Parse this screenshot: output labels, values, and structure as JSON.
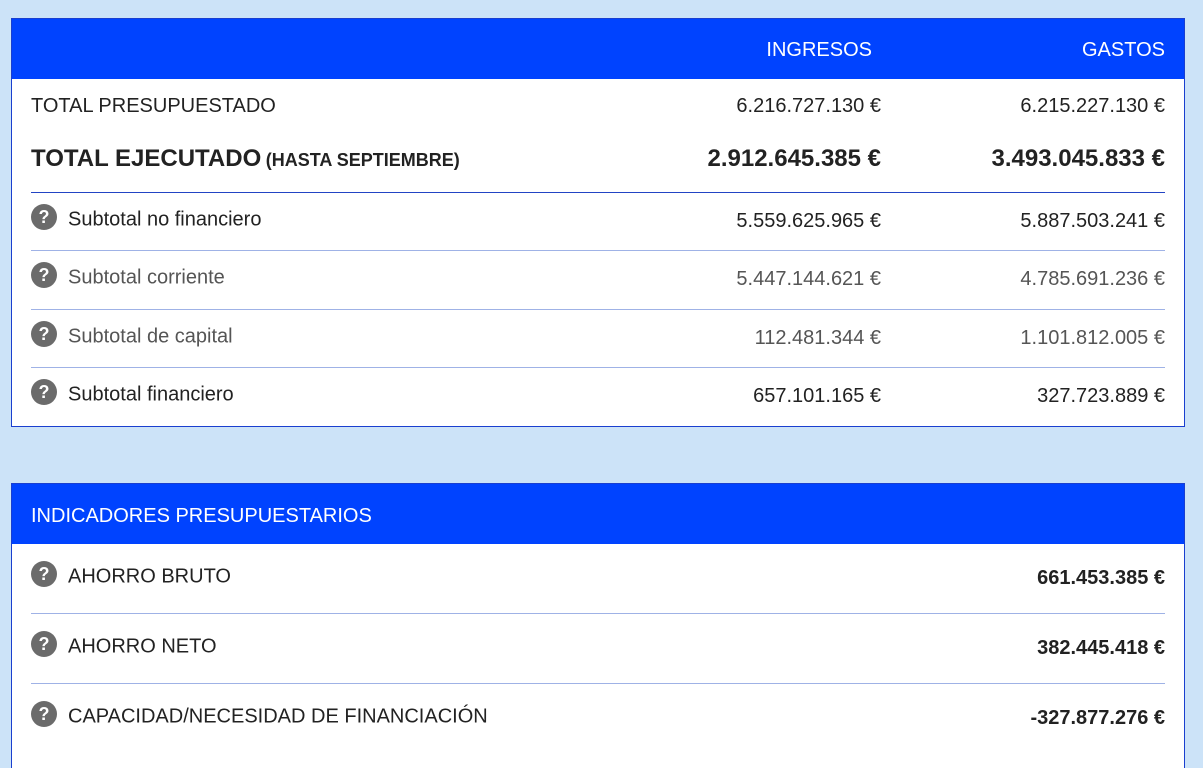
{
  "summary": {
    "headers": {
      "ingresos": "INGRESOS",
      "gastos": "GASTOS"
    },
    "presupuestado": {
      "label": "TOTAL PRESUPUESTADO",
      "ingresos": "6.216.727.130 €",
      "gastos": "6.215.227.130 €"
    },
    "ejecutado": {
      "label": "TOTAL EJECUTADO",
      "sublabel": "(HASTA SEPTIEMBRE)",
      "ingresos": "2.912.645.385 €",
      "gastos": "3.493.045.833 €"
    },
    "rows": [
      {
        "label": "Subtotal no financiero",
        "ingresos": "5.559.625.965 €",
        "gastos": "5.887.503.241 €"
      },
      {
        "label": "Subtotal corriente",
        "ingresos": "5.447.144.621 €",
        "gastos": "4.785.691.236 €"
      },
      {
        "label": "Subtotal de capital",
        "ingresos": "112.481.344 €",
        "gastos": "1.101.812.005 €"
      },
      {
        "label": "Subtotal financiero",
        "ingresos": "657.101.165 €",
        "gastos": "327.723.889 €"
      }
    ]
  },
  "indicators": {
    "title": "INDICADORES PRESUPUESTARIOS",
    "rows": [
      {
        "label": "AHORRO BRUTO",
        "value": "661.453.385 €"
      },
      {
        "label": "AHORRO NETO",
        "value": "382.445.418 €"
      },
      {
        "label": "CAPACIDAD/NECESIDAD DE FINANCIACIÓN",
        "value": "-327.877.276 €"
      }
    ]
  },
  "help_glyph": "?",
  "colors": {
    "header_bg": "#0043ff",
    "page_bg": "#cce3f8",
    "help_icon_bg": "#6b6b6b"
  }
}
